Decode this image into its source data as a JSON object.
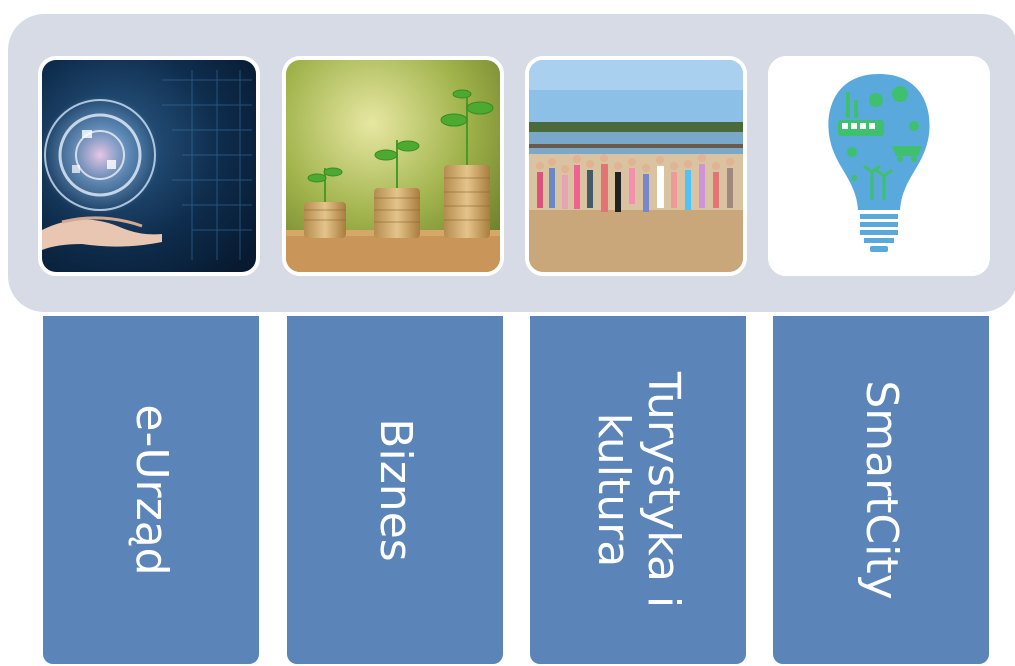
{
  "tiles": [
    {
      "label": "e-Urząd",
      "image": "digital-hand-globe"
    },
    {
      "label": "Bizness",
      "image": "coins-plants"
    },
    {
      "label": "Turystyka i kultura",
      "image": "beach-crowd"
    },
    {
      "label": "SmartCity",
      "image": "lightbulb-city"
    }
  ],
  "labels": {
    "e_urzad": "e-Urząd",
    "biznes": "Biznes",
    "turystyka_line1": "Turystyka i",
    "turystyka_line2": "kultura",
    "smartcity": "SmartCity"
  },
  "colors": {
    "card_blue": "#5b84b9",
    "strip_gray": "#d7dbe6",
    "bulb_blue": "#59a9dc",
    "bulb_green": "#3fc06f"
  }
}
